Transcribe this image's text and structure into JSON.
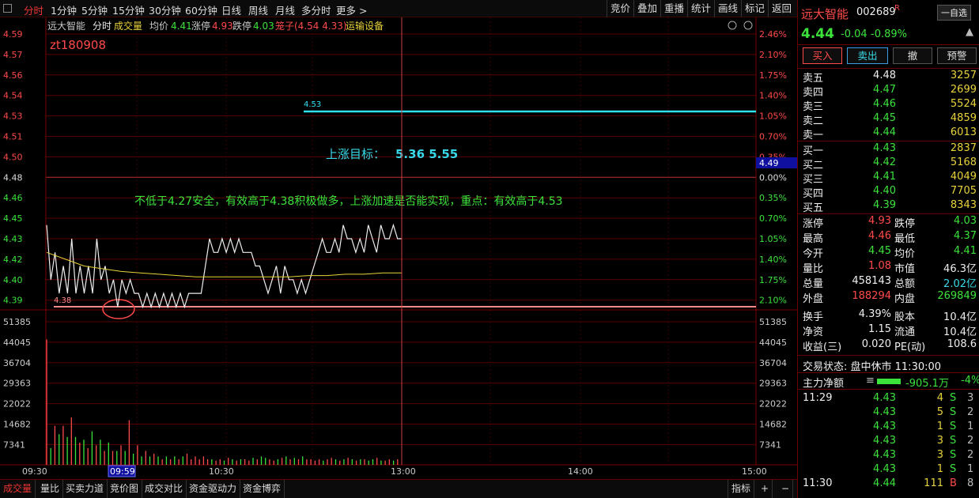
{
  "toolbar": {
    "periods": [
      "分时",
      "1分钟",
      "5分钟",
      "15分钟",
      "30分钟",
      "60分钟",
      "日线",
      "周线",
      "月线",
      "多分时",
      "更多 >"
    ],
    "right": [
      "竞价",
      "叠加",
      "重播",
      "统计",
      "画线",
      "标记",
      "返回"
    ]
  },
  "chart_header": {
    "name": "远大智能",
    "mode": "分时",
    "volume_label": "成交量",
    "avg_label": "均价",
    "avg": "4.41",
    "limit_up_label": "涨停",
    "limit_up": "4.93",
    "limit_down_label": "跌停",
    "limit_down": "4.03",
    "sub_label": "笼子(4.54 4.33)",
    "industry": "运输设备"
  },
  "annotations": {
    "tag": "zt180908",
    "target_label": "上涨目标：",
    "target_values": "5.36  5.55",
    "note": "不低于4.27安全，有效高于4.38积极做多，上涨加速是否能实现，重点：有效高于4.53",
    "line_upper": "4.53",
    "line_lower": "4.38",
    "cursor_price": "4.49",
    "cursor_time": "09:59"
  },
  "axes": {
    "price_ticks": [
      "4.59",
      "4.57",
      "4.56",
      "4.54",
      "4.53",
      "4.51",
      "4.50",
      "4.48",
      "4.46",
      "4.45",
      "4.43",
      "4.42",
      "4.40",
      "4.39"
    ],
    "pct_ticks": [
      "2.46%",
      "2.10%",
      "1.75%",
      "1.40%",
      "1.05%",
      "0.70%",
      "0.35%",
      "0.00%",
      "0.35%",
      "0.70%",
      "1.05%",
      "1.40%",
      "1.75%",
      "2.10%"
    ],
    "vol_ticks": [
      "51385",
      "44045",
      "36704",
      "29363",
      "22022",
      "14682",
      "7341"
    ],
    "time_ticks": [
      "09:30",
      "10:30",
      "13:00",
      "14:00",
      "15:00"
    ]
  },
  "chart_data": {
    "type": "line",
    "prev_close": 4.48,
    "y_range": [
      4.38,
      4.59
    ],
    "price": [
      4.45,
      4.41,
      4.43,
      4.4,
      4.42,
      4.4,
      4.44,
      4.4,
      4.42,
      4.4,
      4.42,
      4.4,
      4.44,
      4.41,
      4.42,
      4.4,
      4.41,
      4.39,
      4.41,
      4.4,
      4.41,
      4.4,
      4.4,
      4.39,
      4.4,
      4.39,
      4.4,
      4.39,
      4.4,
      4.39,
      4.4,
      4.39,
      4.4,
      4.39,
      4.4,
      4.4,
      4.4,
      4.4,
      4.42,
      4.44,
      4.43,
      4.43,
      4.44,
      4.43,
      4.44,
      4.43,
      4.44,
      4.43,
      4.43,
      4.43,
      4.42,
      4.42,
      4.41,
      4.4,
      4.41,
      4.42,
      4.4,
      4.42,
      4.41,
      4.41,
      4.4,
      4.41,
      4.4,
      4.41,
      4.42,
      4.43,
      4.44,
      4.43,
      4.43,
      4.44,
      4.43,
      4.45,
      4.44,
      4.44,
      4.43,
      4.44,
      4.43,
      4.45,
      4.44,
      4.43,
      4.45,
      4.44,
      4.44,
      4.45,
      4.44,
      4.44
    ],
    "avg": [
      4.43,
      4.425,
      4.42,
      4.418,
      4.416,
      4.415,
      4.414,
      4.413,
      4.412,
      4.412,
      4.412,
      4.412,
      4.412,
      4.412,
      4.413,
      4.413,
      4.414,
      4.414,
      4.415,
      4.415
    ],
    "volume": [
      45000,
      6000,
      14000,
      11000,
      14000,
      10000,
      17000,
      10000,
      8000,
      9000,
      6000,
      12000,
      7000,
      9000,
      5000,
      8000,
      5000,
      5000,
      7000,
      5000,
      16000,
      4000,
      7000,
      3000,
      5000,
      3000,
      4000,
      3000,
      2000,
      3000,
      2000,
      3000,
      2000,
      3000,
      4000,
      2000,
      3000,
      2000,
      3000,
      2000,
      2000,
      1500,
      2000,
      1500,
      2500,
      2000,
      1500,
      2000,
      2000,
      1500,
      2500,
      2000,
      3000,
      2500,
      2000,
      1500,
      2000,
      2500,
      3000,
      2000,
      2500,
      2000,
      3000,
      2000,
      2000,
      1500,
      2000,
      1500,
      2000,
      2500,
      2000,
      1500,
      2000,
      2500,
      2000,
      1500,
      2000,
      2000,
      1500,
      2000,
      2500,
      1500,
      1500,
      2000,
      1500,
      2000
    ],
    "volume_colors": "red for up, green for down"
  },
  "right_panel": {
    "name": "远大智能",
    "code": "002689",
    "badge": "R",
    "self_select": "一自选",
    "price": "4.44",
    "change": "-0.04",
    "change_pct": "-0.89%",
    "buttons": [
      "买入",
      "卖出",
      "撤",
      "预警"
    ],
    "asks": [
      {
        "label": "卖五",
        "price": "4.48",
        "vol": "3257"
      },
      {
        "label": "卖四",
        "price": "4.47",
        "vol": "2699"
      },
      {
        "label": "卖三",
        "price": "4.46",
        "vol": "5524"
      },
      {
        "label": "卖二",
        "price": "4.45",
        "vol": "4859"
      },
      {
        "label": "卖一",
        "price": "4.44",
        "vol": "6013"
      }
    ],
    "bids": [
      {
        "label": "买一",
        "price": "4.43",
        "vol": "2837"
      },
      {
        "label": "买二",
        "price": "4.42",
        "vol": "5168"
      },
      {
        "label": "买三",
        "price": "4.41",
        "vol": "4049"
      },
      {
        "label": "买四",
        "price": "4.40",
        "vol": "7705"
      },
      {
        "label": "买五",
        "price": "4.39",
        "vol": "8343"
      }
    ],
    "stats": [
      [
        "涨停",
        "4.93",
        "跌停",
        "4.03"
      ],
      [
        "最高",
        "4.46",
        "最低",
        "4.37"
      ],
      [
        "今开",
        "4.45",
        "均价",
        "4.41"
      ],
      [
        "量比",
        "1.08",
        "市值",
        "46.3亿"
      ],
      [
        "总量",
        "458143",
        "总额",
        "2.02亿"
      ],
      [
        "外盘",
        "188294",
        "内盘",
        "269849"
      ],
      [
        "换手",
        "4.39%",
        "股本",
        "10.4亿"
      ],
      [
        "净资",
        "1.15",
        "流通",
        "10.4亿"
      ],
      [
        "收益(三)",
        "0.020",
        "PE(动)",
        "108.6"
      ]
    ],
    "status": "交易状态: 盘中休市 11:30:00",
    "main_flow_label": "主力净额",
    "main_flow": "-905.1万",
    "main_flow_pct": "-4%",
    "ticks": [
      {
        "t": "11:29",
        "p": "4.43",
        "v": "4",
        "d": "S",
        "n": "3"
      },
      {
        "t": "",
        "p": "4.43",
        "v": "5",
        "d": "S",
        "n": "2"
      },
      {
        "t": "",
        "p": "4.43",
        "v": "1",
        "d": "S",
        "n": "1"
      },
      {
        "t": "",
        "p": "4.43",
        "v": "3",
        "d": "S",
        "n": "2"
      },
      {
        "t": "",
        "p": "4.43",
        "v": "3",
        "d": "S",
        "n": "2"
      },
      {
        "t": "",
        "p": "4.43",
        "v": "1",
        "d": "S",
        "n": "1"
      },
      {
        "t": "11:30",
        "p": "4.44",
        "v": "111",
        "d": "B",
        "n": "8"
      }
    ]
  },
  "bottom_tabs": [
    "成交量",
    "量比",
    "买卖力道",
    "竞价图",
    "成交对比",
    "资金驱动力",
    "资金博弈"
  ],
  "bottom_right": [
    "指标",
    "+",
    "−"
  ]
}
